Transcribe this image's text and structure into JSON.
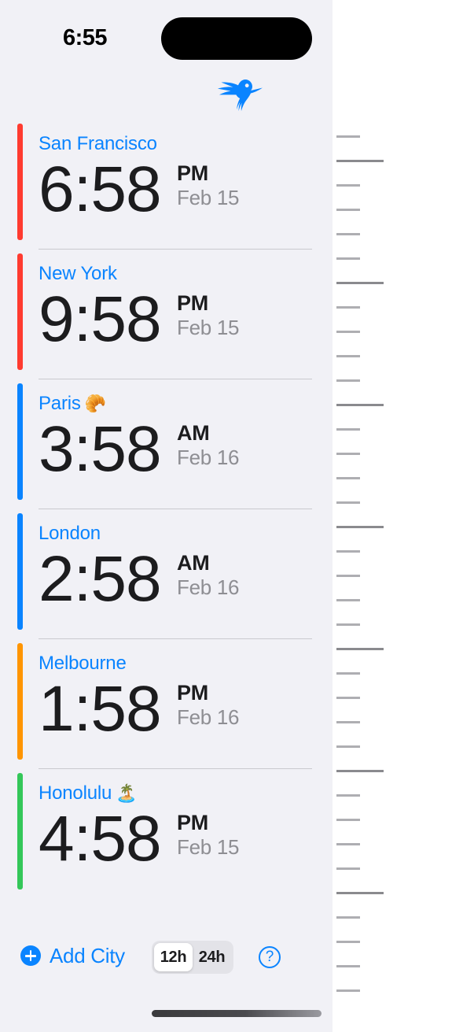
{
  "status_bar": {
    "time": "6:55",
    "signal_icon": "signal-dots-icon",
    "wifi_icon": "wifi-icon",
    "battery_icon": "battery-icon"
  },
  "app": {
    "logo_icon": "hummingbird-logo-icon",
    "accent_color": "#0A84FF",
    "background_color": "#F1F1F6"
  },
  "cities": [
    {
      "name": "San Francisco",
      "emoji": "",
      "time": "6:58",
      "meridiem": "PM",
      "date": "Feb 15",
      "accent_color": "#FF3B30"
    },
    {
      "name": "New York",
      "emoji": "",
      "time": "9:58",
      "meridiem": "PM",
      "date": "Feb 15",
      "accent_color": "#FF3B30"
    },
    {
      "name": "Paris",
      "emoji": "🥐",
      "time": "3:58",
      "meridiem": "AM",
      "date": "Feb 16",
      "accent_color": "#0A84FF"
    },
    {
      "name": "London",
      "emoji": "",
      "time": "2:58",
      "meridiem": "AM",
      "date": "Feb 16",
      "accent_color": "#0A84FF"
    },
    {
      "name": "Melbourne",
      "emoji": "",
      "time": "1:58",
      "meridiem": "PM",
      "date": "Feb 16",
      "accent_color": "#FF9500"
    },
    {
      "name": "Honolulu",
      "emoji": "🏝️",
      "time": "4:58",
      "meridiem": "PM",
      "date": "Feb 15",
      "accent_color": "#34C759"
    }
  ],
  "toolbar": {
    "add_city_label": "Add City",
    "add_icon": "plus-circle-icon",
    "help_label": "?",
    "help_icon": "question-mark-circle-icon",
    "time_format_options": [
      "12h",
      "24h"
    ],
    "time_format_selected": "12h"
  },
  "ruler": {
    "first_tick_y": 172,
    "spacing": 31,
    "tick_count": 36,
    "major_every": 5,
    "minor_color": "#AEAEB2",
    "major_color": "#8A8A8E"
  }
}
